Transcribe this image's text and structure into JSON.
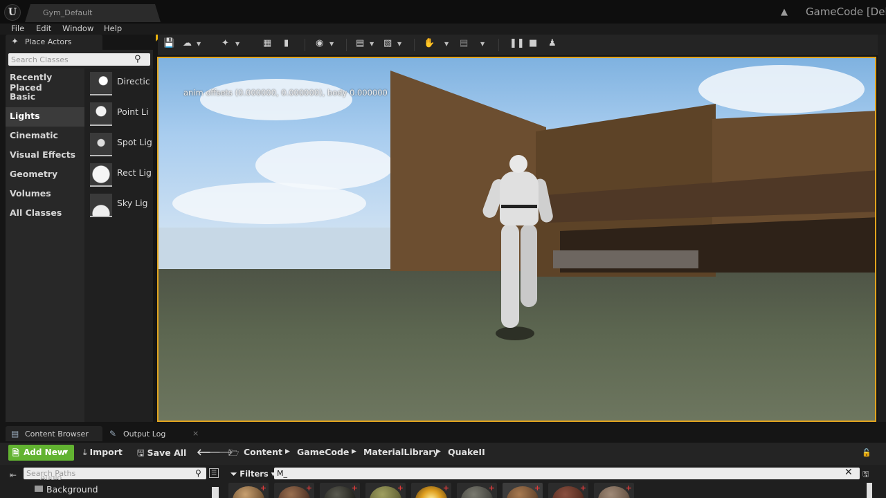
{
  "window": {
    "tab_title": "Gym_Default",
    "project_name": "GameCode [Debu",
    "logo_text": "U"
  },
  "menu": [
    "File",
    "Edit",
    "Window",
    "Help"
  ],
  "place_actors": {
    "tab_label": "Place Actors",
    "search_placeholder": "Search Classes",
    "categories": [
      "Recently Placed",
      "Basic",
      "Lights",
      "Cinematic",
      "Visual Effects",
      "Geometry",
      "Volumes",
      "All Classes"
    ],
    "active_category": "Lights",
    "actors": [
      {
        "label": "Directic",
        "icon": "directional-light-icon"
      },
      {
        "label": "Point Li",
        "icon": "point-light-icon"
      },
      {
        "label": "Spot Lig",
        "icon": "spot-light-icon"
      },
      {
        "label": "Rect Lig",
        "icon": "rect-light-icon"
      },
      {
        "label": "Sky Lig",
        "icon": "sky-light-icon"
      }
    ]
  },
  "toolbar": {
    "icons": [
      "save-icon",
      "source-control-icon",
      "modes-icon",
      "content-icon",
      "blueprints-icon",
      "cinematics-icon",
      "build-icon",
      "compile-icon",
      "play-icon",
      "launch-icon",
      "pause-icon",
      "stop-icon",
      "eject-icon"
    ]
  },
  "viewport": {
    "debug_text": "anim offsets (0.000000, 0.000000), body 0.000000",
    "border_color": "#e2a41d"
  },
  "bottom_tabs": [
    {
      "label": "Content Browser",
      "icon": "content-browser-icon"
    },
    {
      "label": "Output Log",
      "icon": "output-log-icon"
    }
  ],
  "content_browser": {
    "add_new_label": "Add New",
    "import_label": "Import",
    "save_all_label": "Save All",
    "breadcrumb": [
      "Content",
      "GameCode",
      "MaterialLibrary",
      "QuakeII"
    ],
    "search_paths_placeholder": "Search Paths",
    "tree_items": [
      "Audio",
      "Background"
    ],
    "filters_label": "Filters",
    "filter_value": "M_",
    "accent_color": "#62b331"
  },
  "asset_thumbs": [
    {
      "color": "#7a5a38",
      "name": "material-thumb"
    },
    {
      "color": "#5a3a2a",
      "name": "material-thumb"
    },
    {
      "color": "#2a2a24",
      "name": "material-thumb"
    },
    {
      "color": "#6a6a3a",
      "name": "material-thumb"
    },
    {
      "color": "#e0a020",
      "name": "material-thumb"
    },
    {
      "color": "#4a4a44",
      "name": "material-thumb"
    },
    {
      "color": "#6b4a30",
      "name": "material-thumb"
    },
    {
      "color": "#5a2e22",
      "name": "material-thumb"
    },
    {
      "color": "#6e5a4a",
      "name": "material-thumb"
    }
  ]
}
